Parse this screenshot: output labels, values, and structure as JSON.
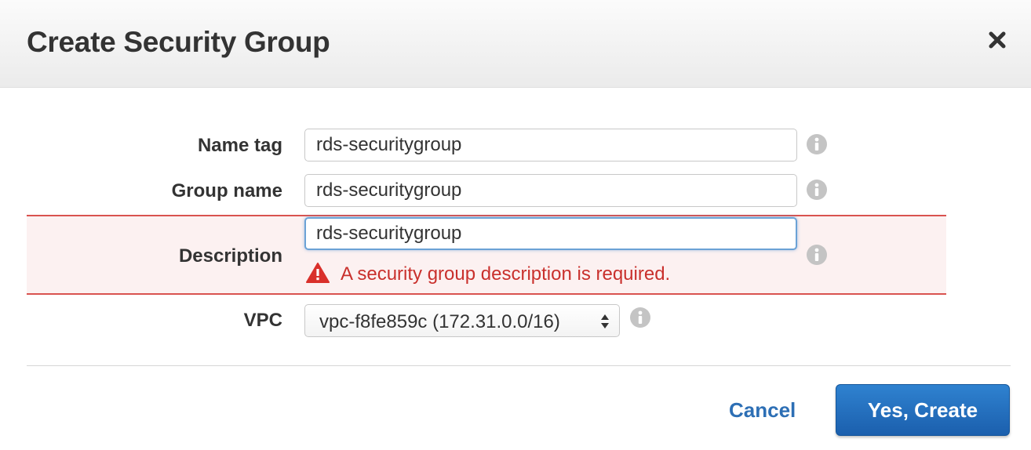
{
  "dialog": {
    "title": "Create Security Group",
    "close_icon": "close-icon"
  },
  "form": {
    "name_tag": {
      "label": "Name tag",
      "value": "rds-securitygroup",
      "info_icon": "info-icon"
    },
    "group_name": {
      "label": "Group name",
      "value": "rds-securitygroup",
      "info_icon": "info-icon"
    },
    "description": {
      "label": "Description",
      "value": "rds-securitygroup",
      "error": "A security group description is required.",
      "error_icon": "warning-icon",
      "info_icon": "info-icon"
    },
    "vpc": {
      "label": "VPC",
      "selected": "vpc-f8fe859c (172.31.0.0/16)",
      "info_icon": "info-icon"
    }
  },
  "footer": {
    "cancel_label": "Cancel",
    "confirm_label": "Yes, Create"
  },
  "colors": {
    "error": "#d9534f",
    "error_background": "#fcf1f1",
    "link": "#2d6fb5",
    "primary_button": "#2272c3",
    "focus_border": "#6ba2d6"
  }
}
